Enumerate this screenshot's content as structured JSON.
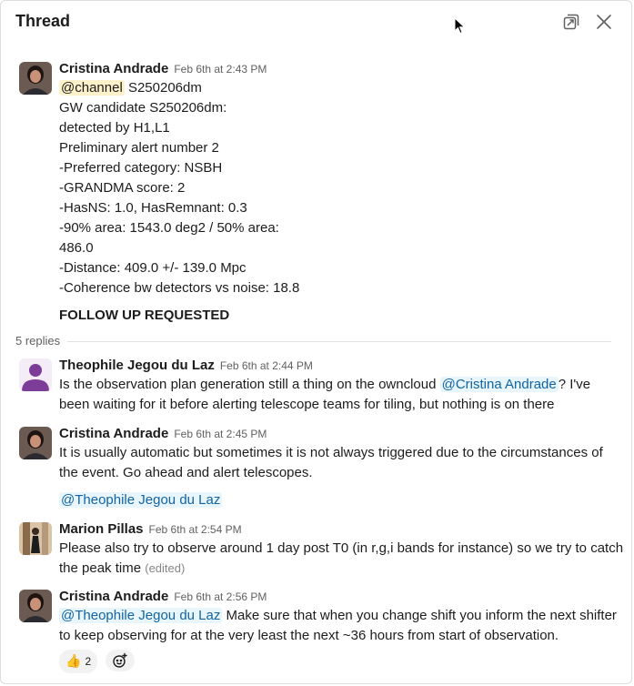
{
  "header": {
    "title": "Thread"
  },
  "parent": {
    "author": "Cristina Andrade",
    "time": "Feb 6th at 2:43 PM",
    "channel_mention": "@channel",
    "channel_suffix": "S250206dm",
    "lines": [
      "GW candidate S250206dm:",
      "detected by H1,L1",
      "Preliminary alert number 2",
      "-Preferred category: NSBH",
      "-GRANDMA score: 2",
      "-HasNS: 1.0, HasRemnant: 0.3",
      "-90% area: 1543.0 deg2 / 50% area:",
      "486.0",
      "-Distance: 409.0 +/- 139.0 Mpc",
      "-Coherence bw detectors vs noise: 18.8"
    ],
    "follow_up": "FOLLOW UP REQUESTED"
  },
  "replies_label": "5 replies",
  "replies": [
    {
      "author": "Theophile Jegou du Laz",
      "time": "Feb 6th at 2:44 PM",
      "line1_before": "Is the observation plan generation still a thing on the owncloud ",
      "line1_mention": "@Cristina Andrade",
      "line1_after": "? I've",
      "line2": "been waiting for it before alerting telescope teams for tiling, but nothing is on there"
    },
    {
      "author": "Cristina Andrade",
      "time": "Feb 6th at 2:45 PM",
      "line1": "It is usually automatic but sometimes it is not always triggered due to the circumstances of",
      "line2": "the event. Go ahead and alert telescopes.",
      "mention": "@Theophile Jegou du Laz"
    },
    {
      "author": "Marion Pillas",
      "time": "Feb 6th at 2:54 PM",
      "line1": "Please also try to observe around 1 day post T0 (in r,g,i bands for instance) so we try to catch",
      "line2": "the peak time",
      "edited": "(edited)"
    },
    {
      "author": "Cristina Andrade",
      "time": "Feb 6th at 2:56 PM",
      "line1_mention": "@Theophile Jegou du Laz",
      "line1_after": " Make sure that when you change shift you inform the next shifter",
      "line2": "to keep observing for at the very least the next ~36 hours from start of observation."
    }
  ],
  "reaction": {
    "emoji": "👍",
    "count": "2"
  },
  "icons": {
    "open_in_new_window": "popout-icon",
    "close": "close-icon",
    "add_reaction": "add-reaction-icon"
  },
  "colors": {
    "mention_user": "#1264a3",
    "mention_user_bg": "#e8f5fa",
    "channel_bg": "#fdf1c9",
    "timestamp": "#616061"
  }
}
